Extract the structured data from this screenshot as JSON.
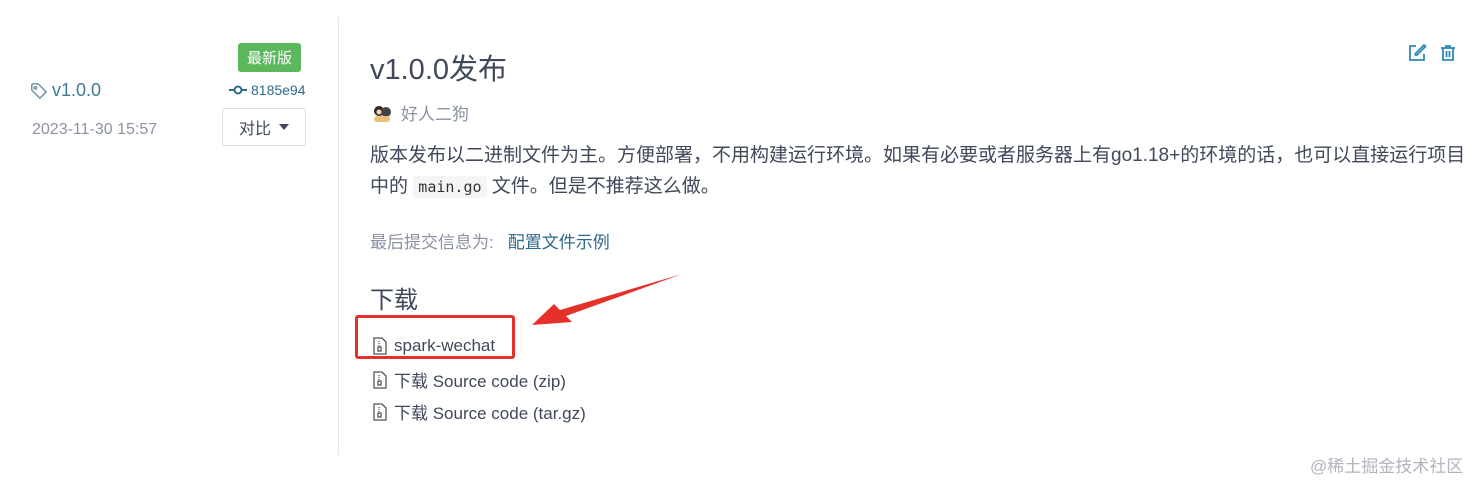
{
  "release": {
    "tag": "v1.0.0",
    "date": "2023-11-30 15:57",
    "badge": "最新版",
    "commit_hash": "8185e94",
    "compare_label": "对比",
    "title": "v1.0.0发布",
    "author": "好人二狗",
    "description_part1": "版本发布以二进制文件为主。方便部署，不用构建运行环境。如果有必要或者服务器上有go1.18+的环境的话，也可以直接运行项目中的",
    "description_code": "main.go",
    "description_part2": "文件。但是不推荐这么做。",
    "last_commit_label": "最后提交信息为:",
    "last_commit_link": "配置文件示例"
  },
  "downloads": {
    "heading": "下载",
    "items": [
      {
        "label": "spark-wechat"
      },
      {
        "label": "下载 Source code (zip)"
      },
      {
        "label": "下载 Source code (tar.gz)"
      }
    ]
  },
  "icons": {
    "tag": "tag-icon",
    "commit": "commit-icon",
    "edit": "edit-icon",
    "delete": "trash-icon",
    "file": "file-archive-icon"
  },
  "colors": {
    "badge": "#5cb85c",
    "link": "#2e6a8a",
    "annotation": "#e5312a"
  },
  "watermark": "@稀土掘金技术社区"
}
